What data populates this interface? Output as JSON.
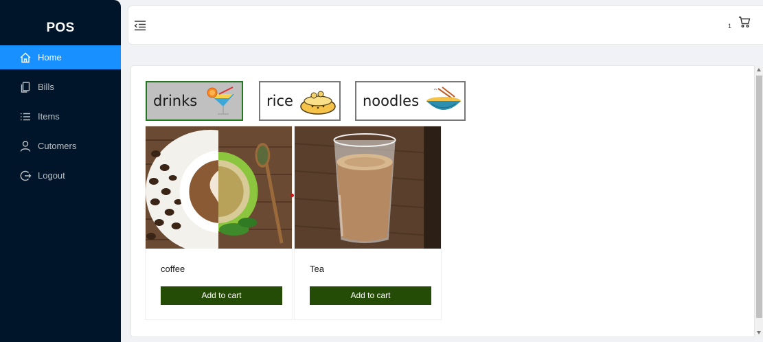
{
  "sidebar": {
    "logo": "POS",
    "items": [
      {
        "label": "Home",
        "icon": "home-icon",
        "active": true
      },
      {
        "label": "Bills",
        "icon": "copy-icon"
      },
      {
        "label": "Items",
        "icon": "list-icon"
      },
      {
        "label": "Cutomers",
        "icon": "user-icon"
      },
      {
        "label": "Logout",
        "icon": "logout-icon"
      }
    ]
  },
  "header": {
    "menu_toggle_icon": "menu-fold-icon",
    "cart_count": "1",
    "cart_icon": "shopping-cart-icon"
  },
  "categories": [
    {
      "label": "drinks",
      "icon": "cocktail-icon",
      "selected": true
    },
    {
      "label": "rice",
      "icon": "rice-pot-icon"
    },
    {
      "label": "noodles",
      "icon": "noodle-bowl-icon"
    }
  ],
  "items": [
    {
      "name": "coffee",
      "button": "Add to cart",
      "image": "coffee-image"
    },
    {
      "name": "Tea",
      "button": "Add to cart",
      "image": "tea-image"
    }
  ],
  "colors": {
    "sidebar_bg": "#001529",
    "active_menu": "#1890ff",
    "add_button": "#254c06",
    "selected_category_border": "#22791f",
    "selected_category_bg": "#c0c0c0"
  }
}
